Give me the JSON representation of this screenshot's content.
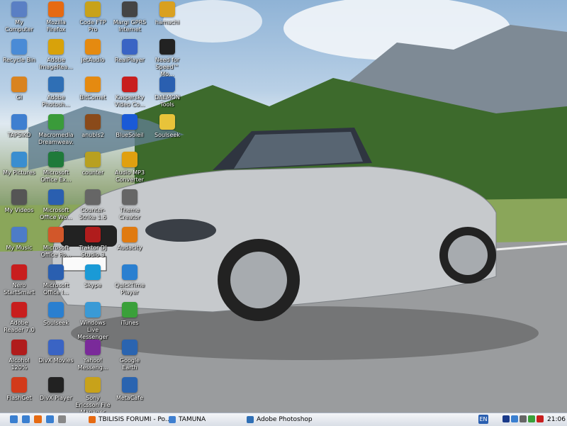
{
  "desktop_icons": [
    {
      "label": "My Computer",
      "icon": "computer-icon",
      "color": "#5a7fc4"
    },
    {
      "label": "Recycle Bin",
      "icon": "recycle-bin-icon",
      "color": "#4a8bd6"
    },
    {
      "label": "GI",
      "icon": "gi-icon",
      "color": "#d9831f"
    },
    {
      "label": "TAPSIKO",
      "icon": "windows-flag-icon",
      "color": "#3f7fd0"
    },
    {
      "label": "My Pictures",
      "icon": "pictures-folder-icon",
      "color": "#3a8ed0"
    },
    {
      "label": "My Videos",
      "icon": "videos-icon",
      "color": "#555555"
    },
    {
      "label": "My Music",
      "icon": "music-icon",
      "color": "#4d7cc7"
    },
    {
      "label": "Nero StartSmart",
      "icon": "nero-icon",
      "color": "#c81e1e"
    },
    {
      "label": "Adobe Reader 7.0",
      "icon": "adobe-reader-icon",
      "color": "#c81e1e"
    },
    {
      "label": "Alcohol 120%",
      "icon": "alcohol-icon",
      "color": "#b01c1c"
    },
    {
      "label": "FlashGet",
      "icon": "flashget-icon",
      "color": "#d23a1a"
    },
    {
      "label": "Mozilla Firefox",
      "icon": "firefox-icon",
      "color": "#e66a12"
    },
    {
      "label": "Adobe ImageRea...",
      "icon": "imageready-icon",
      "color": "#d8a20a"
    },
    {
      "label": "Adobe Photosh...",
      "icon": "photoshop-icon",
      "color": "#2f6fb5"
    },
    {
      "label": "Macromedia Dreamweav...",
      "icon": "dreamweaver-icon",
      "color": "#3a9b3a"
    },
    {
      "label": "Microsoft Office Ex...",
      "icon": "excel-icon",
      "color": "#1f7a3a"
    },
    {
      "label": "Microsoft Office Wo...",
      "icon": "word-icon",
      "color": "#2a5fb0"
    },
    {
      "label": "Microsoft Office Po...",
      "icon": "powerpoint-icon",
      "color": "#d2572a"
    },
    {
      "label": "Microsoft Office I...",
      "icon": "office-icon",
      "color": "#2a5fb0"
    },
    {
      "label": "Soulseek",
      "icon": "soulseek-icon",
      "color": "#2a7fd0"
    },
    {
      "label": "DivX Movies",
      "icon": "divx-movies-icon",
      "color": "#3a64c4"
    },
    {
      "label": "DivX Player",
      "icon": "divx-player-icon",
      "color": "#222222"
    },
    {
      "label": "Code FTP Pro",
      "icon": "ftp-icon",
      "color": "#c8a21a"
    },
    {
      "label": "jetAudio",
      "icon": "jetaudio-icon",
      "color": "#e58a10"
    },
    {
      "label": "BitComet",
      "icon": "bitcomet-icon",
      "color": "#e58a10"
    },
    {
      "label": "anubis2",
      "icon": "anubis-icon",
      "color": "#8a4a1a"
    },
    {
      "label": "counter",
      "icon": "counter-strike-icon",
      "color": "#b8a020"
    },
    {
      "label": "Counter-Strike 1.6",
      "icon": "counter-strike-icon",
      "color": "#666666"
    },
    {
      "label": "Traktor DJ Studio 3",
      "icon": "traktor-icon",
      "color": "#b01c1c"
    },
    {
      "label": "Skype",
      "icon": "skype-icon",
      "color": "#1a9ad6"
    },
    {
      "label": "Windows Live Messenger",
      "icon": "messenger-icon",
      "color": "#3a9ad6"
    },
    {
      "label": "Yahoo! Messeng...",
      "icon": "yahoo-icon",
      "color": "#7a2a9a"
    },
    {
      "label": "Sony Ericsson File Manager",
      "icon": "sony-ericsson-icon",
      "color": "#c8a21a"
    },
    {
      "label": "Margi GPRS Internet",
      "icon": "gprs-icon",
      "color": "#444444"
    },
    {
      "label": "RealPlayer",
      "icon": "realplayer-icon",
      "color": "#3a64c4"
    },
    {
      "label": "Kaspersky Video Co...",
      "icon": "video-converter-icon",
      "color": "#c81e1e"
    },
    {
      "label": "BlueSoleil",
      "icon": "bluetooth-icon",
      "color": "#1a5ad6"
    },
    {
      "label": "Audio MP3 Converter",
      "icon": "mp3-converter-icon",
      "color": "#e0a010"
    },
    {
      "label": "Theme Creator",
      "icon": "theme-creator-icon",
      "color": "#666666"
    },
    {
      "label": "Audacity",
      "icon": "audacity-icon",
      "color": "#e07a10"
    },
    {
      "label": "QuickTime Player",
      "icon": "quicktime-icon",
      "color": "#2a7fd0"
    },
    {
      "label": "iTunes",
      "icon": "itunes-icon",
      "color": "#3aa03a"
    },
    {
      "label": "Google Earth",
      "icon": "google-earth-icon",
      "color": "#2a64b0"
    },
    {
      "label": "MetaCafe",
      "icon": "metacafe-icon",
      "color": "#2a64b0"
    },
    {
      "label": "hamachi",
      "icon": "hamachi-icon",
      "color": "#d9a020"
    },
    {
      "label": "Need for Speed™ Mo...",
      "icon": "nfs-icon",
      "color": "#222222"
    },
    {
      "label": "DAEMON Tools",
      "icon": "daemon-tools-icon",
      "color": "#2a5fb0"
    },
    {
      "label": "Soulseek",
      "icon": "folder-icon",
      "color": "#e8c33a"
    }
  ],
  "taskbar": {
    "quick_launch": [
      {
        "icon": "start-icon",
        "color": "#3a7fd0"
      },
      {
        "icon": "show-desktop-icon",
        "color": "#3a7fd0"
      },
      {
        "icon": "firefox-icon",
        "color": "#e66a12"
      },
      {
        "icon": "explorer-icon",
        "color": "#3a7fd0"
      },
      {
        "icon": "notepad-icon",
        "color": "#888888"
      }
    ],
    "tasks": [
      {
        "label": "TBILISIS FORUMI - Po...",
        "icon": "firefox-icon",
        "color": "#e66a12"
      },
      {
        "label": "TAMUNA",
        "icon": "windows-flag-icon",
        "color": "#3f7fd0"
      },
      {
        "label": "Adobe Photoshop",
        "icon": "photoshop-icon",
        "color": "#2f6fb5"
      }
    ],
    "language": "EN",
    "tray_icons": [
      {
        "icon": "network-icon",
        "color": "#1a3a8a"
      },
      {
        "icon": "phone-icon",
        "color": "#3a7fd0"
      },
      {
        "icon": "volume-icon",
        "color": "#666666"
      },
      {
        "icon": "messenger-tray-icon",
        "color": "#3aa03a"
      },
      {
        "icon": "antivirus-icon",
        "color": "#c81e1e"
      }
    ],
    "clock": "21:06"
  }
}
